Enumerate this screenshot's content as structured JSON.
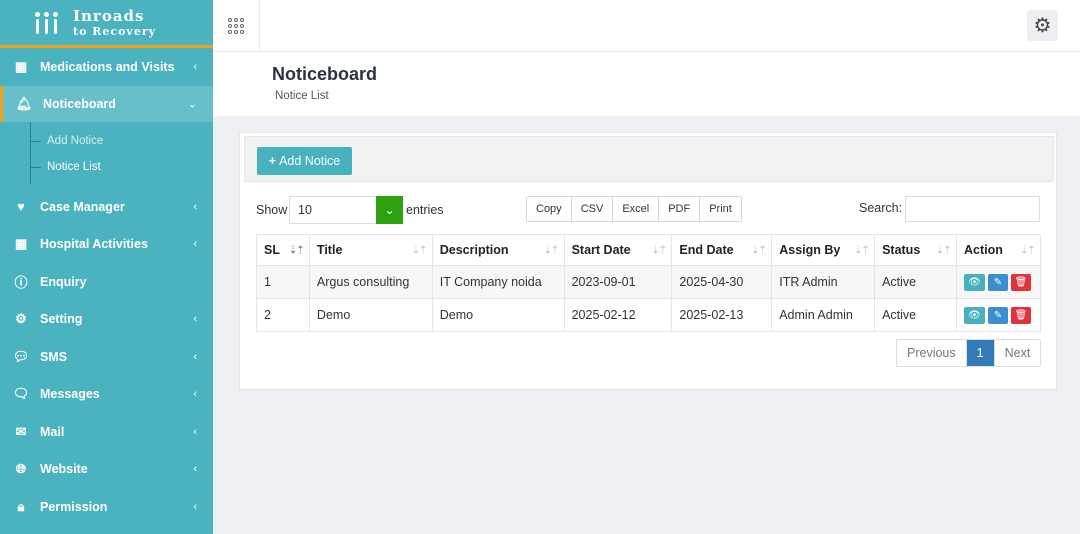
{
  "brand": {
    "line1": "Inroads",
    "line2": "to Recovery"
  },
  "sidebar": {
    "items": [
      {
        "label": "Medications and Visits",
        "icon": "building-icon"
      },
      {
        "label": "Noticeboard",
        "icon": "bell-icon"
      },
      {
        "label": "Case Manager",
        "icon": "heart-pulse-icon"
      },
      {
        "label": "Hospital Activities",
        "icon": "building-icon"
      },
      {
        "label": "Enquiry",
        "icon": "question-circle-icon"
      },
      {
        "label": "Setting",
        "icon": "gear-icon"
      },
      {
        "label": "SMS",
        "icon": "chat-dots-icon"
      },
      {
        "label": "Messages",
        "icon": "chats-icon"
      },
      {
        "label": "Mail",
        "icon": "envelope-icon"
      },
      {
        "label": "Website",
        "icon": "globe-icon"
      },
      {
        "label": "Permission",
        "icon": "lock-icon"
      }
    ],
    "sub_items": [
      {
        "label": "Add Notice"
      },
      {
        "label": "Notice List"
      }
    ]
  },
  "header": {
    "title": "Noticeboard",
    "subtitle": "Notice List"
  },
  "toolbar": {
    "add_label": "Add Notice"
  },
  "controls": {
    "show_label": "Show",
    "entries_value": "10",
    "entries_label": "entries",
    "export_buttons": [
      "Copy",
      "CSV",
      "Excel",
      "PDF",
      "Print"
    ],
    "search_label": "Search:",
    "search_value": ""
  },
  "table": {
    "columns": [
      "SL",
      "Title",
      "Description",
      "Start Date",
      "End Date",
      "Assign By",
      "Status",
      "Action"
    ],
    "rows": [
      {
        "sl": "1",
        "title": "Argus consulting",
        "description": "IT Company noida",
        "start": "2023-09-01",
        "end": "2025-04-30",
        "assign_by": "ITR Admin",
        "status": "Active"
      },
      {
        "sl": "2",
        "title": "Demo",
        "description": "Demo",
        "start": "2025-02-12",
        "end": "2025-02-13",
        "assign_by": "Admin Admin",
        "status": "Active"
      }
    ]
  },
  "pagination": {
    "prev": "Previous",
    "current": "1",
    "next": "Next"
  },
  "colors": {
    "sidebar": "#4bb3bf",
    "accent": "#f0a21a",
    "primary_btn": "#48b1be",
    "select_arrow": "#2fa10f",
    "edit": "#3a8fd1",
    "delete": "#e0333b",
    "page_active": "#337ab7"
  }
}
